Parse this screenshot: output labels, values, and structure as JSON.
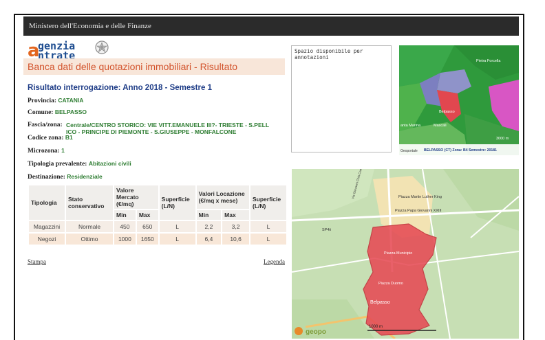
{
  "header": {
    "ministry": "Ministero dell'Economia e delle Finanze"
  },
  "logo": {
    "line1": "genzia",
    "line2": "ntrate",
    "letter": "a"
  },
  "page": {
    "title": "Banca dati delle quotazioni immobiliari - Risultato",
    "result_heading": "Risultato interrogazione: Anno 2018 - Semestre 1"
  },
  "info": {
    "provincia_label": "Provincia:",
    "provincia": "CATANIA",
    "comune_label": "Comune:",
    "comune": "BELPASSO",
    "fascia_label": "Fascia/zona:",
    "fascia_1": "Centrale/CENTRO STORICO: VIE VITT.EMANUELE III?- TRIESTE - S.PELL",
    "fascia_2": "ICO - PRINCIPE DI PIEMONTE - S.GIUSEPPE - MONFALCONE",
    "codice_label": "Codice zona:",
    "codice": "B1",
    "microzona_label": "Microzona:",
    "microzona": "1",
    "tipologia_label": "Tipologia prevalente:",
    "tipologia": "Abitazioni civili",
    "destinazione_label": "Destinazione:",
    "destinazione": "Residenziale"
  },
  "table": {
    "h_tipologia": "Tipologia",
    "h_stato": "Stato conservativo",
    "h_valore": "Valore Mercato (€/mq)",
    "h_superficie": "Superficie (L/N)",
    "h_locazione": "Valori Locazione (€/mq x mese)",
    "h_superficie2": "Superficie (L/N)",
    "h_min": "Min",
    "h_max": "Max",
    "h_min2": "Min",
    "h_max2": "Max",
    "rows": [
      {
        "tipologia": "Magazzini",
        "stato": "Normale",
        "vmin": "450",
        "vmax": "650",
        "sup": "L",
        "lmin": "2,2",
        "lmax": "3,2",
        "sup2": "L"
      },
      {
        "tipologia": "Negozi",
        "stato": "Ottimo",
        "vmin": "1000",
        "vmax": "1650",
        "sup": "L",
        "lmin": "6,4",
        "lmax": "10,6",
        "sup2": "L"
      }
    ]
  },
  "links": {
    "stampa": "Stampa",
    "legenda": "Legenda"
  },
  "notes": {
    "text": "Spazio disponibile per annotazioni"
  },
  "map_small": {
    "labels": {
      "petra": "Pietra Forcella",
      "belpasso": "Belpasso",
      "marina": "anta Marina",
      "mascali": "Mascali",
      "scale": "3000 m",
      "brand": "Geoportale",
      "caption": "BELPASSO (CT) Zona: B4 Semestre: 20181"
    }
  },
  "map_large": {
    "labels": {
      "martin": "Piazza Martin Luther King",
      "papa": "Piazza Papa Giovanni XXIII",
      "municipio": "Piazza Municipio",
      "duomo": "Piazza Duomo",
      "belpasso": "Belpasso",
      "sp4": "SP4ii",
      "scale": "1000 m",
      "brand": "geopo",
      "road1": "Via Giovanni Chia Campoalegria"
    }
  },
  "colors": {
    "accent_orange": "#d2532c",
    "heading_blue": "#1f3d87",
    "value_green": "#2e7d32",
    "zone_red": "#e64b55"
  }
}
